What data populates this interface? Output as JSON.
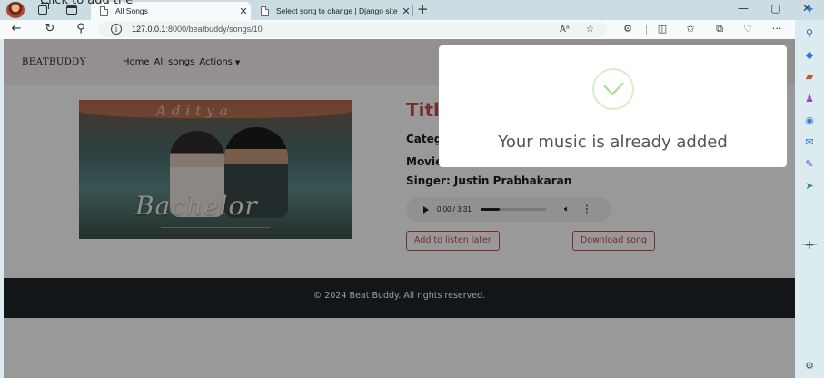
{
  "overlay_text": "Click to add the",
  "browser": {
    "tabs": [
      {
        "title": "All Songs",
        "active": true
      },
      {
        "title": "Select song to change | Django site admin",
        "active": false
      }
    ],
    "url_host": "127.0.0.1",
    "url_rest": ":8000/beatbuddy/songs/10",
    "window_controls": {
      "minimize": "—",
      "maximize": "▢",
      "close": "✕"
    }
  },
  "site": {
    "brand": "BEATBUDDY",
    "nav": [
      "Home",
      "All songs",
      "Actions"
    ]
  },
  "poster": {
    "script_text": "Aditya",
    "title_text": "Bachelor"
  },
  "song": {
    "title": "Title",
    "category": "Category",
    "movie": "Movie",
    "singer": "Singer: Justin Prabhakaran",
    "time": "0:00 / 3:31",
    "progress": 0.3
  },
  "buttons": {
    "listen_later": "Add to listen later",
    "download": "Download song"
  },
  "footer": {
    "copyright": "© 2024 Beat Buddy. All rights reserved."
  },
  "modal": {
    "message": "Your music is already added"
  },
  "colors": {
    "accent": "#c44b4e",
    "footer": "#212529",
    "success": "#a5dc86"
  }
}
